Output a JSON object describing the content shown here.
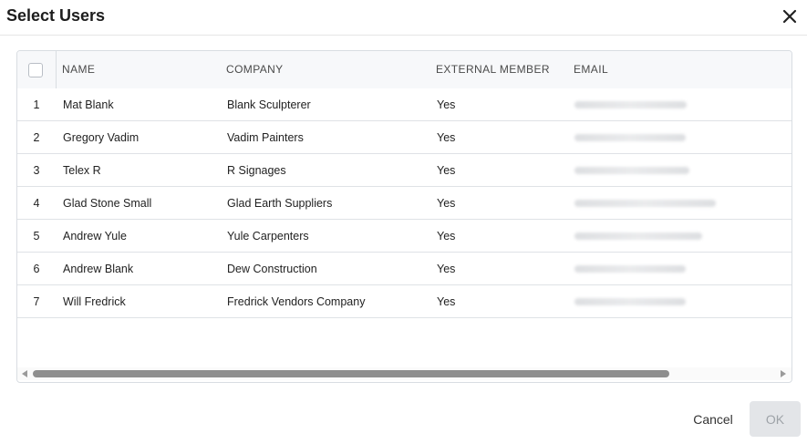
{
  "dialog": {
    "title": "Select Users",
    "cancel_label": "Cancel",
    "ok_label": "OK"
  },
  "table": {
    "columns": [
      "NAME",
      "COMPANY",
      "EXTERNAL MEMBER",
      "EMAIL"
    ],
    "rows": [
      {
        "num": "1",
        "name": "Mat Blank",
        "company": "Blank Sculpterer",
        "external": "Yes"
      },
      {
        "num": "2",
        "name": "Gregory Vadim",
        "company": "Vadim Painters",
        "external": "Yes"
      },
      {
        "num": "3",
        "name": "Telex R",
        "company": "R Signages",
        "external": "Yes"
      },
      {
        "num": "4",
        "name": "Glad Stone Small",
        "company": "Glad Earth Suppliers",
        "external": "Yes"
      },
      {
        "num": "5",
        "name": "Andrew Yule",
        "company": "Yule Carpenters",
        "external": "Yes"
      },
      {
        "num": "6",
        "name": "Andrew Blank",
        "company": "Dew Construction",
        "external": "Yes"
      },
      {
        "num": "7",
        "name": "Will Fredrick",
        "company": "Fredrick Vendors Company",
        "external": "Yes"
      }
    ]
  },
  "icons": {
    "close": "close-icon",
    "scroll_left": "arrow-left-icon",
    "scroll_right": "arrow-right-icon"
  }
}
